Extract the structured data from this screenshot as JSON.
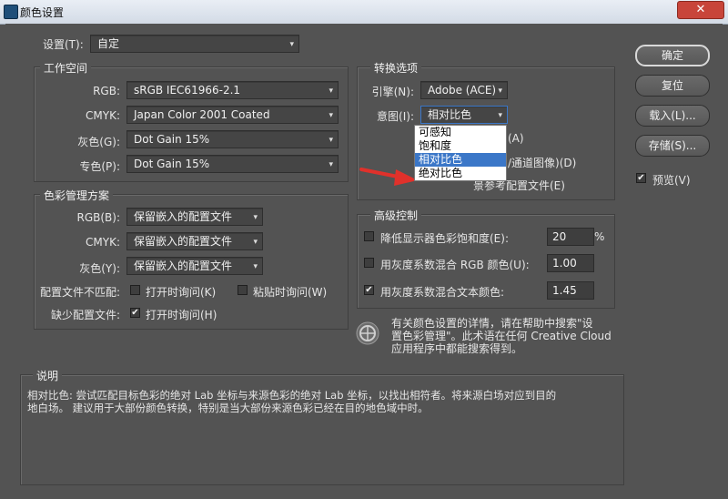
{
  "window": {
    "title": "颜色设置",
    "close": "✕"
  },
  "settings": {
    "label": "设置(T):",
    "value": "自定"
  },
  "workspace": {
    "title": "工作空间",
    "rgb": {
      "label": "RGB:",
      "value": "sRGB IEC61966-2.1"
    },
    "cmyk": {
      "label": "CMYK:",
      "value": "Japan Color 2001 Coated"
    },
    "gray": {
      "label": "灰色(G):",
      "value": "Dot Gain 15%"
    },
    "spot": {
      "label": "专色(P):",
      "value": "Dot Gain 15%"
    }
  },
  "policies": {
    "title": "色彩管理方案",
    "rgb": {
      "label": "RGB(B):",
      "value": "保留嵌入的配置文件"
    },
    "cmyk": {
      "label": "CMYK:",
      "value": "保留嵌入的配置文件"
    },
    "gray": {
      "label": "灰色(Y):",
      "value": "保留嵌入的配置文件"
    },
    "mismatch_label": "配置文件不匹配:",
    "mismatch_open": "打开时询问(K)",
    "mismatch_paste": "粘贴时询问(W)",
    "missing_label": "缺少配置文件:",
    "missing_open": "打开时询问(H)"
  },
  "conversion": {
    "title": "转换选项",
    "engine": {
      "label": "引擎(N):",
      "value": "Adobe (ACE)"
    },
    "intent": {
      "label": "意图(I):",
      "value": "相对比色"
    },
    "opt_blackpoint_tail": "(A)",
    "opt_dither_tail": "/通道图像)(D)",
    "opt_compensate_tail": "景参考配置文件(E)",
    "intent_options": [
      "可感知",
      "饱和度",
      "相对比色",
      "绝对比色"
    ],
    "highlighted_index": 2
  },
  "advanced": {
    "title": "高级控制",
    "desat": {
      "label": "降低显示器色彩饱和度(E):",
      "value": "20",
      "unit": "%",
      "checked": false
    },
    "blend_rgb": {
      "label": "用灰度系数混合 RGB 颜色(U):",
      "value": "1.00",
      "checked": false
    },
    "blend_text": {
      "label": "用灰度系数混合文本颜色:",
      "value": "1.45",
      "checked": true
    }
  },
  "info": {
    "line1": "有关颜色设置的详情，请在帮助中搜索\"设",
    "line2": "置色彩管理\"。此术语在任何 Creative Cloud",
    "line3": "应用程序中都能搜索得到。"
  },
  "description": {
    "title": "说明",
    "line1": "相对比色: 尝试匹配目标色彩的绝对 Lab 坐标与来源色彩的绝对 Lab 坐标，以找出相符者。将来源白场对应到目的",
    "line2": "地白场。  建议用于大部份颜色转换，特别是当大部份来源色彩已经在目的地色域中时。"
  },
  "buttons": {
    "ok": "确定",
    "reset": "复位",
    "load": "载入(L)...",
    "save": "存储(S)..."
  },
  "preview": {
    "label": "预览(V)",
    "checked": true
  },
  "marks": {
    "check": "✔",
    "arrow": "▾"
  },
  "colors": {
    "background": "#535353",
    "highlight": "#3b77c8",
    "red_arrow": "#e0312b"
  }
}
